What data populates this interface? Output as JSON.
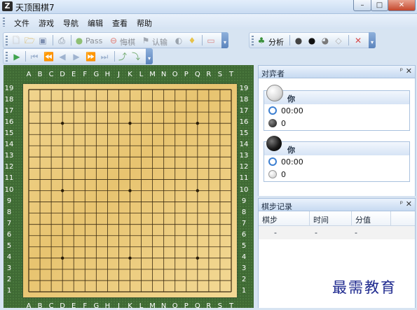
{
  "window": {
    "title": "天顶围棋7",
    "icon_glyph": "Z"
  },
  "menu": [
    "文件",
    "游戏",
    "导航",
    "编辑",
    "查看",
    "帮助"
  ],
  "toolbar": {
    "pass_label": "Pass",
    "undo_label": "悔棋",
    "resign_label": "认输",
    "analyze_label": "分析"
  },
  "board": {
    "size": 19,
    "columns": [
      "A",
      "B",
      "C",
      "D",
      "E",
      "F",
      "G",
      "H",
      "J",
      "K",
      "L",
      "M",
      "N",
      "O",
      "P",
      "Q",
      "R",
      "S",
      "T"
    ],
    "rows": [
      "19",
      "18",
      "17",
      "16",
      "15",
      "14",
      "13",
      "12",
      "11",
      "10",
      "9",
      "8",
      "7",
      "6",
      "5",
      "4",
      "3",
      "2",
      "1"
    ],
    "star_points": [
      "D16",
      "K16",
      "Q16",
      "D10",
      "K10",
      "Q10",
      "D4",
      "K4",
      "Q4"
    ]
  },
  "players_panel": {
    "title": "对弈者",
    "white": {
      "name": "你",
      "time": "00:00",
      "captures": "0"
    },
    "black": {
      "name": "你",
      "time": "00:00",
      "captures": "0"
    }
  },
  "moves_panel": {
    "title": "棋步记录",
    "columns": [
      "棋步",
      "时间",
      "分值"
    ],
    "rows": [
      [
        "-",
        "-",
        "-"
      ]
    ]
  },
  "panel_buttons": {
    "pin": "ᵖ",
    "close": "✕"
  },
  "watermark": "最需教育",
  "colors": {
    "board_wood": "#e8c470",
    "board_frame": "#3f6a34",
    "accent": "#3c7fd1"
  }
}
